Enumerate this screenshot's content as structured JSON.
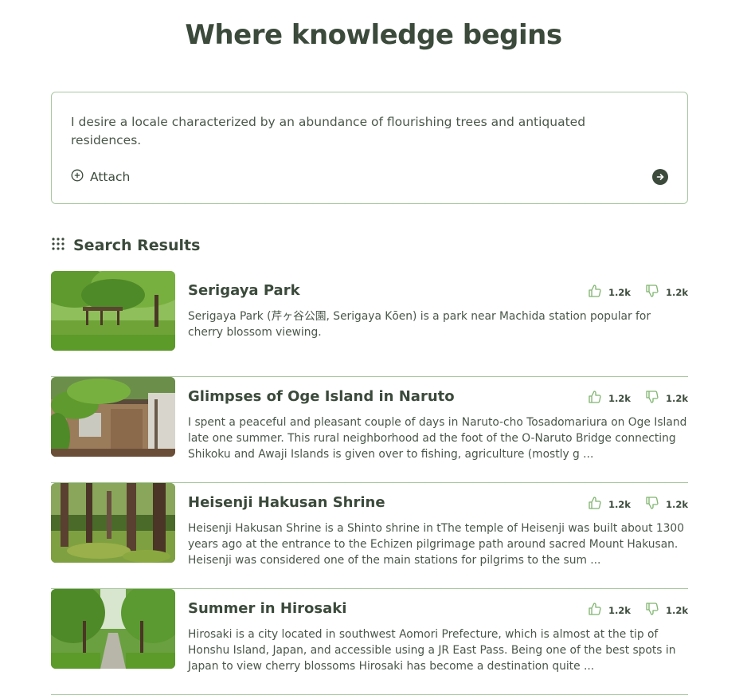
{
  "header": {
    "title": "Where knowledge begins"
  },
  "search": {
    "query": "I desire a locale characterized by an abundance of flourishing trees and antiquated residences.",
    "attach_label": "Attach",
    "attach_icon": "plus-circle-icon",
    "send_icon": "arrow-right-circle-icon"
  },
  "results_section": {
    "title": "Search Results",
    "icon": "grid-dots-icon"
  },
  "results": [
    {
      "title": "Serigaya Park",
      "snippet": "Serigaya Park (芹ヶ谷公園, Serigaya Kōen) is a park near Machida station popular for cherry blossom viewing.",
      "likes": "1.2k",
      "dislikes": "1.2k"
    },
    {
      "title": "Glimpses of Oge Island in Naruto",
      "snippet": "I spent a peaceful and pleasant couple of days in Naruto-cho Tosadomariura on Oge Island late one summer. This rural neighborhood ad the foot of the O-Naruto Bridge connecting Shikoku and Awaji Islands is given over to fishing, agriculture (mostly g ...",
      "likes": "1.2k",
      "dislikes": "1.2k"
    },
    {
      "title": "Heisenji Hakusan Shrine",
      "snippet": "Heisenji Hakusan Shrine is a Shinto shrine in tThe temple of Heisenji was built about 1300 years ago at the entrance to the Echizen pilgrimage path around sacred Mount Hakusan. Heisenji was considered one of the main stations for pilgrims to the sum ...",
      "likes": "1.2k",
      "dislikes": "1.2k"
    },
    {
      "title": "Summer in Hirosaki",
      "snippet": "Hirosaki is a city located in southwest Aomori Prefecture, which is almost at the tip of Honshu Island, Japan, and accessible using a JR East Pass. Being one of the best spots in Japan to view cherry blossoms Hirosaki has become a destination quite ...",
      "likes": "1.2k",
      "dislikes": "1.2k"
    }
  ],
  "colors": {
    "accent": "#3b4a3b",
    "border": "#a9c7a0",
    "thumb_icon": "#7fb46e"
  }
}
